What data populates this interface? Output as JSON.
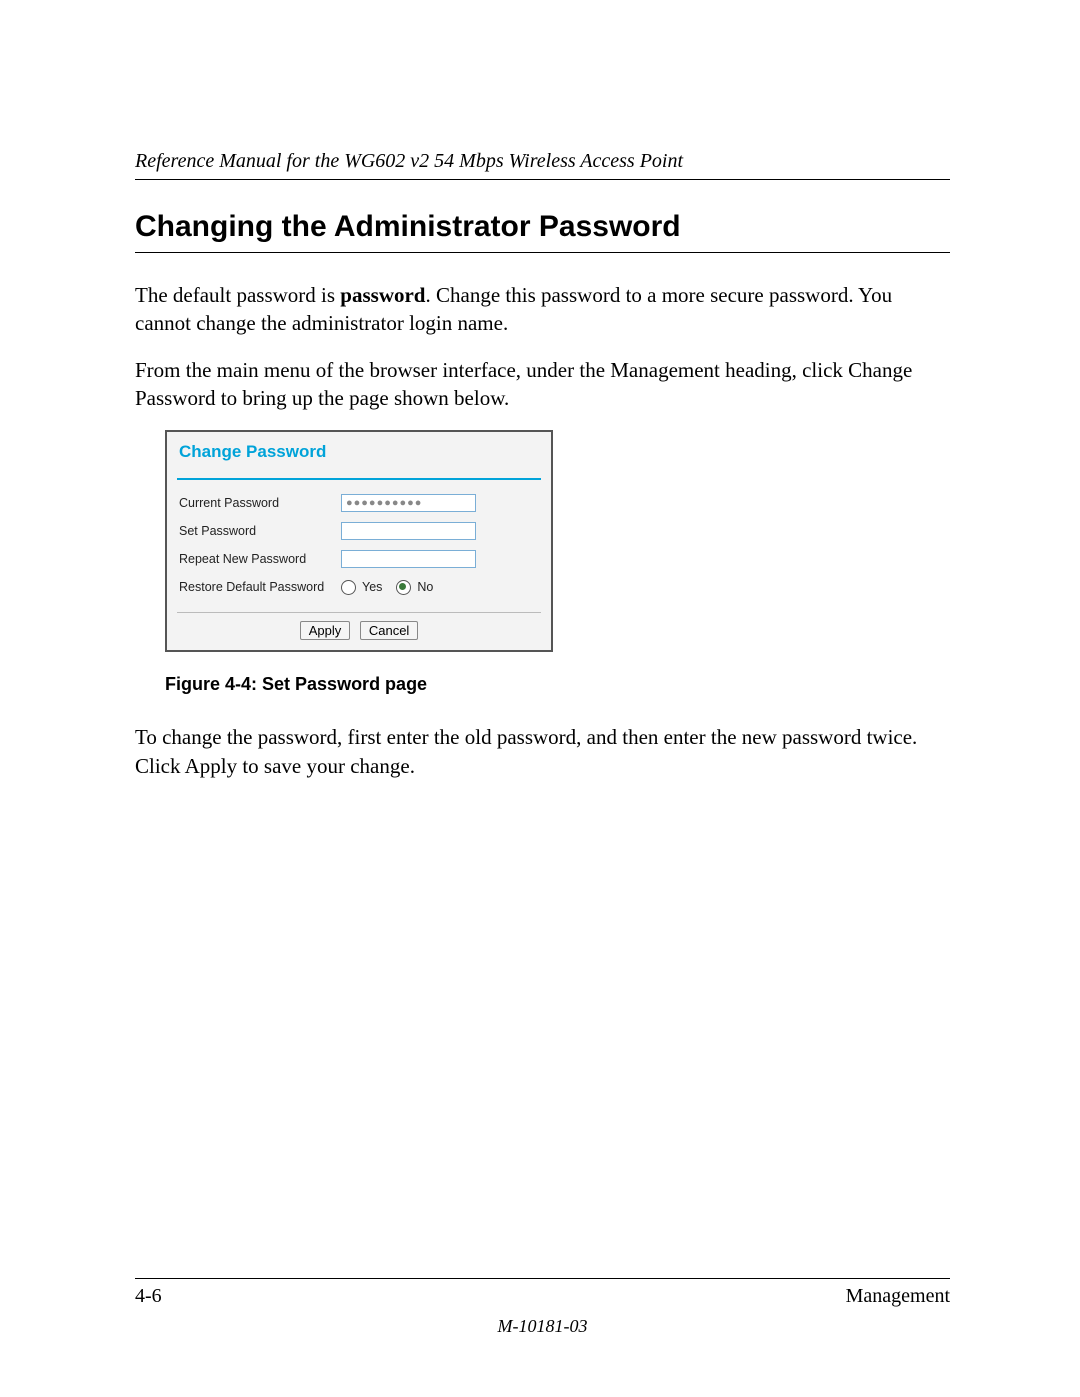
{
  "header": {
    "running_title": "Reference Manual for the WG602 v2 54 Mbps Wireless Access Point"
  },
  "section": {
    "title": "Changing the Administrator Password"
  },
  "paragraphs": {
    "p1_a": "The default password is ",
    "p1_bold": "password",
    "p1_b": ". Change this password to a more secure password. You cannot change the administrator login name.",
    "p2": "From the main menu of the browser interface, under the Management heading, click Change Password to bring up the page shown below.",
    "p3": "To change the password, first enter the old password, and then enter the new password twice. Click Apply to save your change."
  },
  "figure": {
    "ui": {
      "title": "Change Password",
      "rows": {
        "current_password_label": "Current Password",
        "current_password_value": "●●●●●●●●●●",
        "set_password_label": "Set Password",
        "set_password_value": "",
        "repeat_password_label": "Repeat New Password",
        "repeat_password_value": "",
        "restore_default_label": "Restore Default Password",
        "radio_yes": "Yes",
        "radio_no": "No",
        "radio_selected": "No"
      },
      "buttons": {
        "apply": "Apply",
        "cancel": "Cancel"
      }
    },
    "caption": "Figure 4-4:  Set Password page"
  },
  "footer": {
    "page_number": "4-6",
    "section_name": "Management",
    "doc_id": "M-10181-03"
  }
}
